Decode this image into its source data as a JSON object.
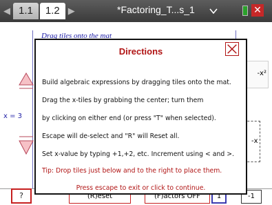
{
  "tabs": [
    {
      "label": "1.1"
    },
    {
      "label": "1.2"
    }
  ],
  "document": {
    "title": "*Factoring_T...s_1"
  },
  "background": {
    "header_text": "Drag tiles onto the mat",
    "x_value": "x = 3",
    "tile_neg_x2": "-x²",
    "tile_neg_x": "-x",
    "help_label": "?",
    "reset_label": "(R)eset",
    "factors_label": "(F)actors OFF",
    "small_button_1": "1",
    "small_button_2": "-1"
  },
  "directions": {
    "title": "Directions",
    "lines": [
      "Build algebraic expressions by dragging tiles onto the mat.",
      "Drag the x-tiles by grabbing the center; turn them",
      "by clicking on either end (or press \"T\" when selected).",
      "Escape will de-select and \"R\" will Reset all.",
      "Set x-value by typing +1,+2, etc. Increment using < and >."
    ],
    "tip": "Tip: Drop tiles just below and to the right to place them.",
    "footer": "Press escape to exit or click to continue."
  },
  "colors": {
    "accent_red": "#b01414",
    "accent_blue": "#2424a8",
    "arrow_pink": "#f0a0a8"
  }
}
